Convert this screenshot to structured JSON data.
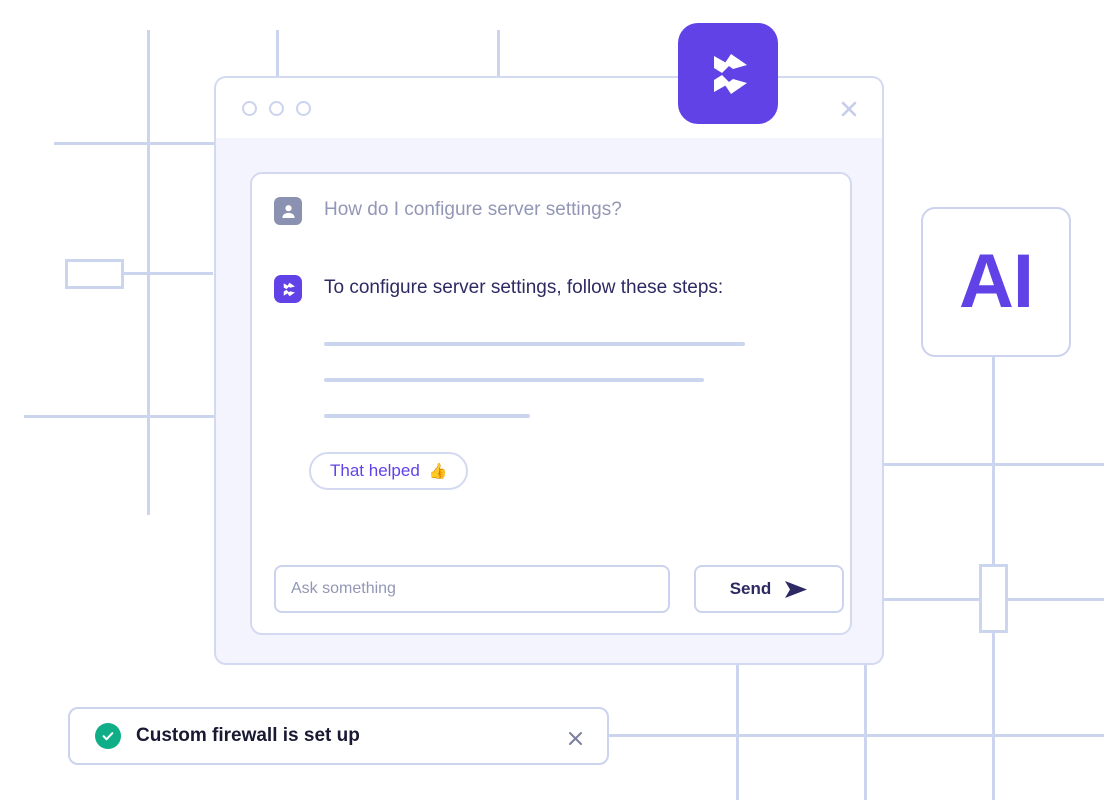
{
  "colors": {
    "brand_purple": "#6142e7",
    "line_lavender": "#ccd5ee",
    "window_body": "#f3f4fd",
    "border_lavender": "#d4d9f2",
    "text_navy": "#2d2a63",
    "text_muted": "#9297b5",
    "success_green": "#0fae86",
    "toast_text": "#191933"
  },
  "app_logo": {
    "icon": "pinwheel-arrow-logo"
  },
  "ai_badge": {
    "label": "AI"
  },
  "chat_window": {
    "titlebar": {
      "traffic_lights": [
        "window-dot-1",
        "window-dot-2",
        "window-dot-3"
      ],
      "close_icon": "close-icon"
    },
    "conversation": [
      {
        "role": "user",
        "avatar_icon": "user-avatar-icon",
        "text": "How do I configure server settings?"
      },
      {
        "role": "assistant",
        "avatar_icon": "pinwheel-arrow-logo",
        "text": "To configure server settings, follow these steps:"
      }
    ],
    "answer_skeleton_widths": [
      421,
      380,
      206
    ],
    "feedback_chip": {
      "label": "That helped",
      "emoji": "👍",
      "emoji_name": "thumbs-up-emoji"
    },
    "composer": {
      "placeholder": "Ask something",
      "value": "",
      "send_label": "Send",
      "send_icon": "send-arrow-icon"
    }
  },
  "toast": {
    "status_icon": "success-check-icon",
    "message": "Custom firewall is set up",
    "close_icon": "close-icon"
  }
}
